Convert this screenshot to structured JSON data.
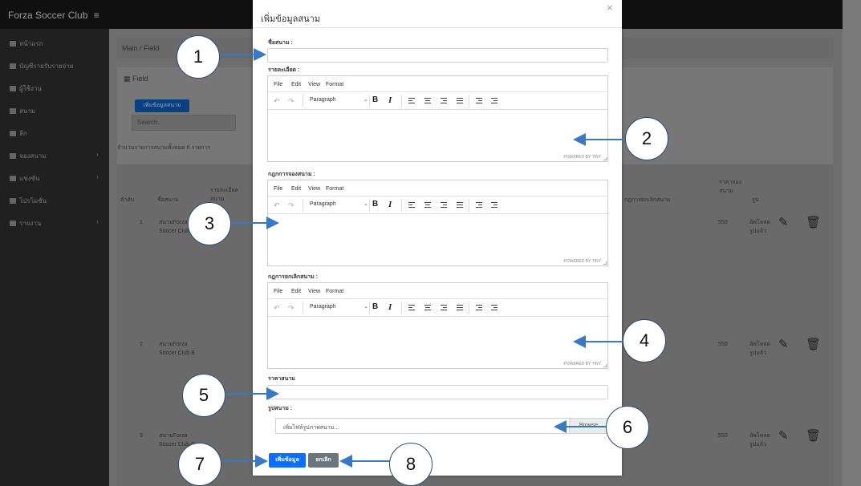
{
  "app": {
    "brand": "Forza Soccer Club",
    "menu_toggle": "≡",
    "sidebar": [
      "หน้าแรก",
      "บัญชีรายรับรายจ่าย",
      "ผู้ใช้งาน",
      "สนาม",
      "ลีก",
      "จองสนาม",
      "แข่งขัน",
      "โปรโมชั่น",
      "รายงาน"
    ],
    "breadcrumb": "Main / Field",
    "card_title": "Field",
    "add_button": "เพิ่มข้อมูลสนาม",
    "search_placeholder": "Search..",
    "count_text": "จำนวนรายการสนามทั้งหมด 6 รายการ",
    "table": {
      "col_no": "ลำดับ",
      "col_name": "ชื่อสนาม",
      "col_detail": "รายละเอียด สนาม",
      "col_cancel": "กฎการยกเลิกสนาม",
      "col_price": "ราคาจอง สนาม",
      "col_image": "รูป",
      "rows": [
        {
          "no": "1",
          "name": "สนามForza Soccer Club A",
          "price": "550",
          "img": "อัพโหลดรูปแล้ว"
        },
        {
          "no": "2",
          "name": "สนามForza Soccer Club B",
          "price": "550",
          "img": "อัพโหลดรูปแล้ว"
        },
        {
          "no": "3",
          "name": "สนามForza Soccer Club C",
          "price": "550",
          "img": "อัพโหลดรูปแล้ว"
        }
      ]
    }
  },
  "modal": {
    "title": "เพิ่มข้อมูลสนาม",
    "close": "×",
    "field_name_label": "ชื่อสนาม :",
    "detail_label": "รายละเอียด :",
    "booking_rules_label": "กฎกการจองสนาม :",
    "cancel_rules_label": "กฎการยกเลิกสนาม :",
    "price_label": "ราคาสนาม",
    "image_label": "รูปสนาม :",
    "file_placeholder": "เพิ่มไฟล์รูปภาพสนาม...",
    "browse": "Browse",
    "submit": "เพิ่มข้อมูล",
    "cancel": "ยกเลิก",
    "editor": {
      "menu": [
        "File",
        "Edit",
        "View",
        "Format"
      ],
      "block_format": "Paragraph",
      "powered_by": "POWERED BY TINY"
    }
  },
  "annotations": [
    "1",
    "2",
    "3",
    "4",
    "5",
    "6",
    "7",
    "8"
  ],
  "colors": {
    "primary": "#0d6efd",
    "secondary": "#6c757d",
    "annotation_border": "#2d4a73",
    "arrow": "#3a78c4"
  }
}
